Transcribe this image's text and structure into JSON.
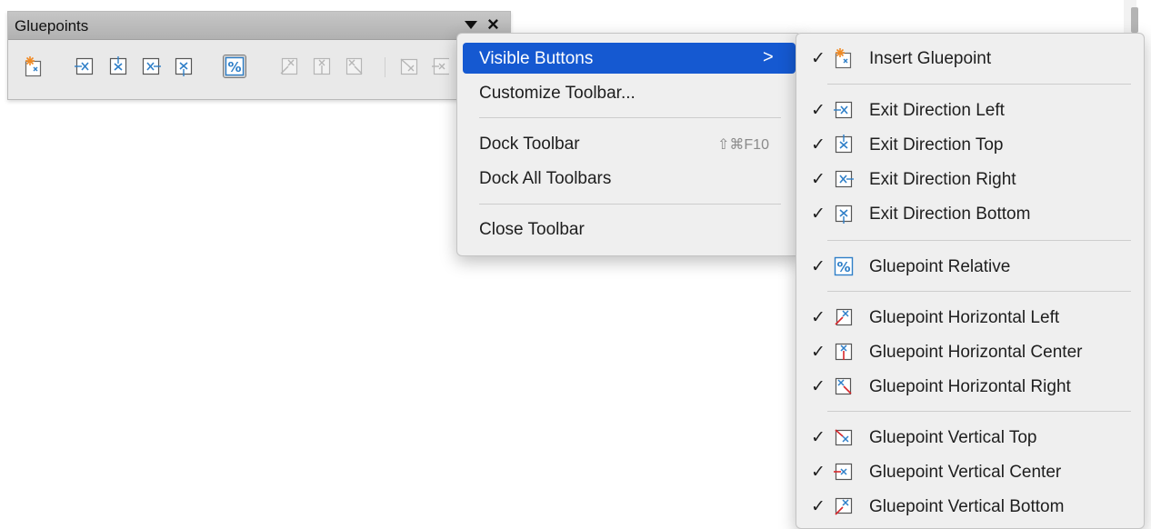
{
  "toolbar": {
    "title": "Gluepoints",
    "buttons": [
      {
        "name": "insert-gluepoint",
        "active": false,
        "disabled": false
      },
      {
        "name": "exit-direction-left",
        "active": false,
        "disabled": false
      },
      {
        "name": "exit-direction-top",
        "active": false,
        "disabled": false
      },
      {
        "name": "exit-direction-right",
        "active": false,
        "disabled": false
      },
      {
        "name": "exit-direction-bottom",
        "active": false,
        "disabled": false
      },
      {
        "name": "gluepoint-relative",
        "active": true,
        "disabled": false
      },
      {
        "name": "gluepoint-horizontal-left",
        "active": false,
        "disabled": true
      },
      {
        "name": "gluepoint-horizontal-center",
        "active": false,
        "disabled": true
      },
      {
        "name": "gluepoint-horizontal-right",
        "active": false,
        "disabled": true
      },
      {
        "name": "gluepoint-vertical-top",
        "active": false,
        "disabled": true
      },
      {
        "name": "gluepoint-vertical-center",
        "active": false,
        "disabled": true
      }
    ]
  },
  "menu": {
    "items": [
      {
        "label": "Visible Buttons",
        "highlighted": true,
        "submenu_arrow": ">"
      },
      {
        "label": "Customize Toolbar..."
      },
      {
        "label": "Dock Toolbar",
        "shortcut": "⇧⌘F10"
      },
      {
        "label": "Dock All Toolbars"
      },
      {
        "label": "Close Toolbar"
      }
    ]
  },
  "submenu": {
    "items": [
      {
        "label": "Insert Gluepoint",
        "checked": true,
        "icon": "insert-gluepoint-icon"
      },
      {
        "label": "Exit Direction Left",
        "checked": true,
        "icon": "exit-direction-left-icon"
      },
      {
        "label": "Exit Direction Top",
        "checked": true,
        "icon": "exit-direction-top-icon"
      },
      {
        "label": "Exit Direction Right",
        "checked": true,
        "icon": "exit-direction-right-icon"
      },
      {
        "label": "Exit Direction Bottom",
        "checked": true,
        "icon": "exit-direction-bottom-icon"
      },
      {
        "label": "Gluepoint Relative",
        "checked": true,
        "icon": "gluepoint-relative-icon"
      },
      {
        "label": "Gluepoint Horizontal Left",
        "checked": true,
        "icon": "gluepoint-horizontal-left-icon"
      },
      {
        "label": "Gluepoint Horizontal Center",
        "checked": true,
        "icon": "gluepoint-horizontal-center-icon"
      },
      {
        "label": "Gluepoint Horizontal Right",
        "checked": true,
        "icon": "gluepoint-horizontal-right-icon"
      },
      {
        "label": "Gluepoint Vertical Top",
        "checked": true,
        "icon": "gluepoint-vertical-top-icon"
      },
      {
        "label": "Gluepoint Vertical Center",
        "checked": true,
        "icon": "gluepoint-vertical-center-icon"
      },
      {
        "label": "Gluepoint Vertical Bottom",
        "checked": true,
        "icon": "gluepoint-vertical-bottom-icon"
      }
    ],
    "check_glyph": "✓"
  },
  "colors": {
    "highlight": "#1559d1",
    "icon_blue": "#2f7fc8",
    "icon_orange": "#f08a24",
    "icon_red": "#d8262b",
    "menu_bg": "#efefef"
  }
}
